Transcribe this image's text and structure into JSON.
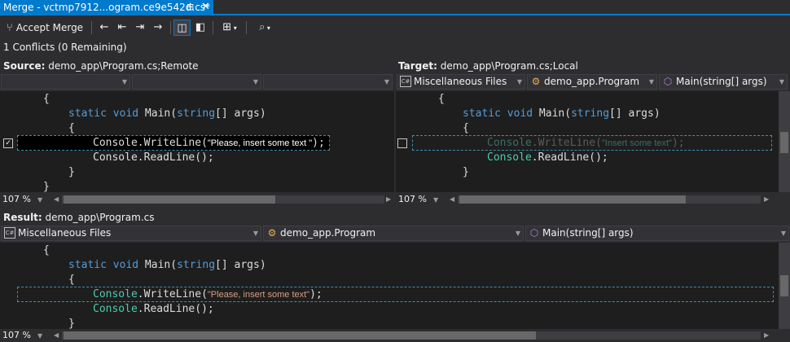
{
  "tab": {
    "title": "Merge - vctmp7912...ogram.ce9e542d.cs*",
    "pin_icon": "pin-icon",
    "close": "✕"
  },
  "toolbar": {
    "accept_merge_label": "Accept Merge"
  },
  "status": {
    "conflicts": "1 Conflicts (0 Remaining)"
  },
  "source": {
    "label": "Source:",
    "path": "demo_app\\Program.cs;Remote",
    "dropdowns": [
      "",
      "",
      ""
    ],
    "zoom": "107 %"
  },
  "target": {
    "label": "Target:",
    "path": "demo_app\\Program.cs;Local",
    "dropdowns": [
      "Miscellaneous Files",
      "demo_app.Program",
      "Main(string[] args)"
    ],
    "zoom": "107 %"
  },
  "result": {
    "label": "Result:",
    "path": "demo_app\\Program.cs",
    "dropdowns": [
      "Miscellaneous Files",
      "demo_app.Program",
      "Main(string[] args)"
    ],
    "zoom": "107 %"
  },
  "code": {
    "open_brace": "{",
    "close_brace": "}",
    "static_kw": "static",
    "void_kw": "void",
    "main_name": " Main(",
    "string_kw": "string",
    "args": "[] args)",
    "console": "Console",
    "writeline": ".WriteLine(",
    "readline": ".ReadLine();",
    "end_paren": ");",
    "source_string": "\"Please, insert some text \"",
    "target_string": "\"Insert some text\"",
    "result_string": "\"Please, insert some text\""
  },
  "checks": {
    "source_checked": "✓",
    "target_checked": ""
  }
}
